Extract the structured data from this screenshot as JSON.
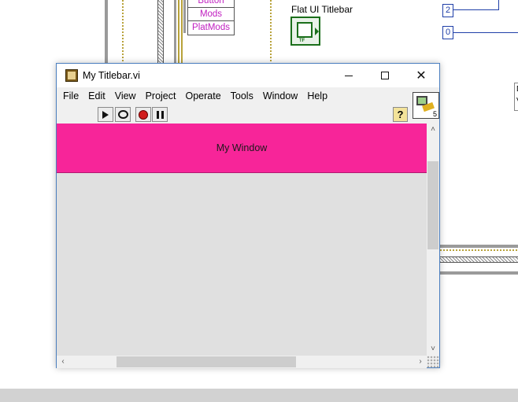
{
  "background": {
    "cluster_items": [
      "Button",
      "Mods",
      "PlatMods"
    ],
    "flat_ui_label": "Flat UI Titlebar",
    "flat_ui_terminal_text": "TF",
    "const_top": "2",
    "const_bottom": "0",
    "right_edge_text": "D\nV"
  },
  "window": {
    "title": "My Titlebar.vi",
    "menu": [
      "File",
      "Edit",
      "View",
      "Project",
      "Operate",
      "Tools",
      "Window",
      "Help"
    ],
    "help_label": "?",
    "vi_icon_number": "5",
    "banner_text": "My Window",
    "banner_color": "#f72599"
  },
  "icons": {
    "app": "labview-vi-icon",
    "minimize": "minimize-icon",
    "maximize": "maximize-icon",
    "close": "close-icon",
    "run": "run-arrow-icon",
    "run_continuously": "run-continuously-icon",
    "abort": "abort-stop-icon",
    "pause": "pause-icon"
  },
  "glyphs": {
    "close": "✕",
    "up": "˄",
    "down": "˅",
    "left": "‹",
    "right": "›"
  }
}
